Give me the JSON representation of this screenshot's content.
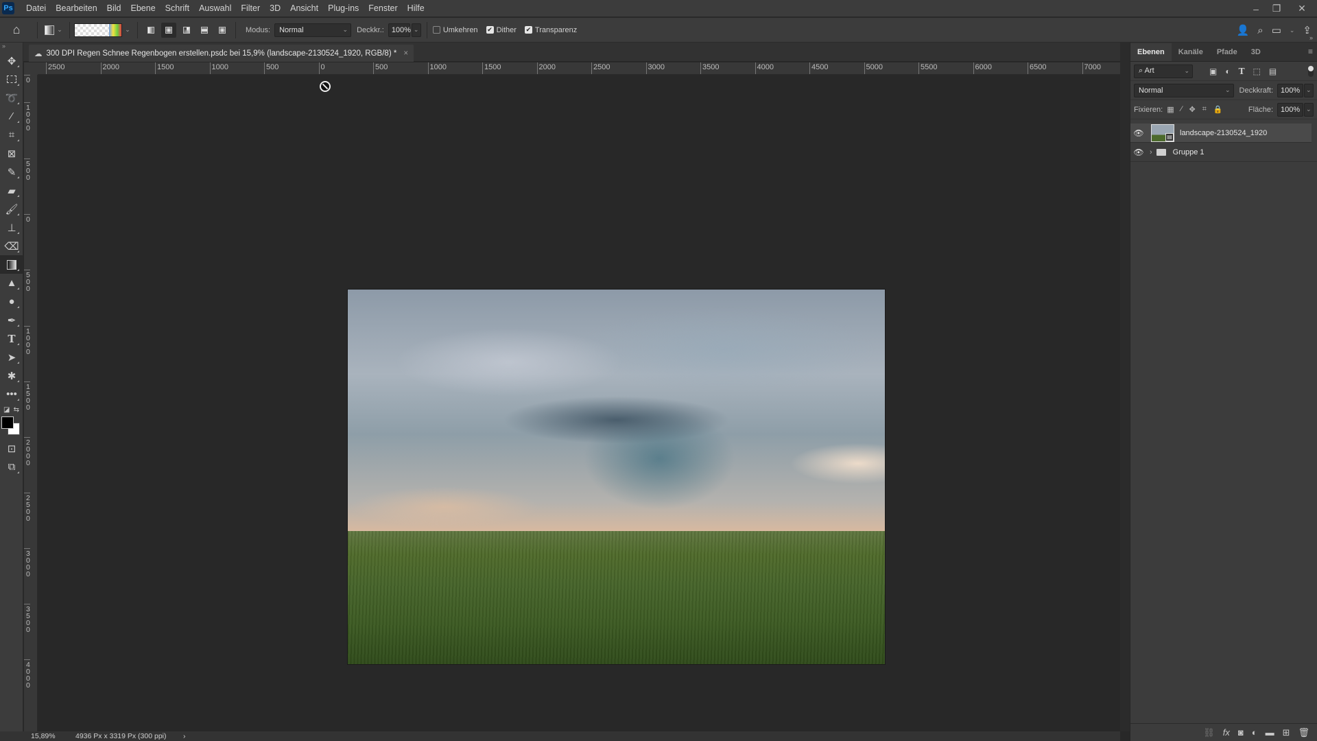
{
  "app": {
    "logo": "Ps"
  },
  "menu": [
    "Datei",
    "Bearbeiten",
    "Bild",
    "Ebene",
    "Schrift",
    "Auswahl",
    "Filter",
    "3D",
    "Ansicht",
    "Plug-ins",
    "Fenster",
    "Hilfe"
  ],
  "window_controls": {
    "minimize": "–",
    "restore": "❐",
    "close": "✕"
  },
  "options": {
    "modus_label": "Modus:",
    "modus_value": "Normal",
    "opacity_label": "Deckkr.:",
    "opacity_value": "100%",
    "umkehren": {
      "label": "Umkehren",
      "checked": false
    },
    "dither": {
      "label": "Dither",
      "checked": true
    },
    "transparenz": {
      "label": "Transparenz",
      "checked": true
    }
  },
  "document_tab": {
    "title": "300 DPI Regen Schnee Regenbogen erstellen.psdc bei 15,9% (landscape-2130524_1920, RGB/8) *",
    "close": "×"
  },
  "rulers": {
    "horizontal": [
      "2500",
      "2000",
      "1500",
      "1000",
      "500",
      "0",
      "500",
      "1000",
      "1500",
      "2000",
      "2500",
      "3000",
      "3500",
      "4000",
      "4500",
      "5000",
      "5500",
      "6000",
      "6500",
      "7000"
    ],
    "vertical": [
      "0",
      "1000",
      "500",
      "0",
      "500",
      "1000",
      "1500",
      "2000",
      "2500",
      "3000",
      "3500",
      "4000"
    ]
  },
  "panel": {
    "tabs": [
      "Ebenen",
      "Kanäle",
      "Pfade",
      "3D"
    ],
    "active_tab": "Ebenen",
    "filter_label": "Art",
    "blend_mode": "Normal",
    "opacity_label": "Deckkraft:",
    "opacity_value": "100%",
    "lock_label": "Fixieren:",
    "fill_label": "Fläche:",
    "fill_value": "100%",
    "layers": [
      {
        "name": "landscape-2130524_1920",
        "visible": true,
        "selected": true,
        "type": "smart-object"
      },
      {
        "name": "Gruppe 1",
        "visible": true,
        "selected": false,
        "type": "group"
      }
    ]
  },
  "status": {
    "zoom": "15,89%",
    "doc_info": "4936 Px x 3319 Px (300 ppi)",
    "arrow": "›"
  }
}
